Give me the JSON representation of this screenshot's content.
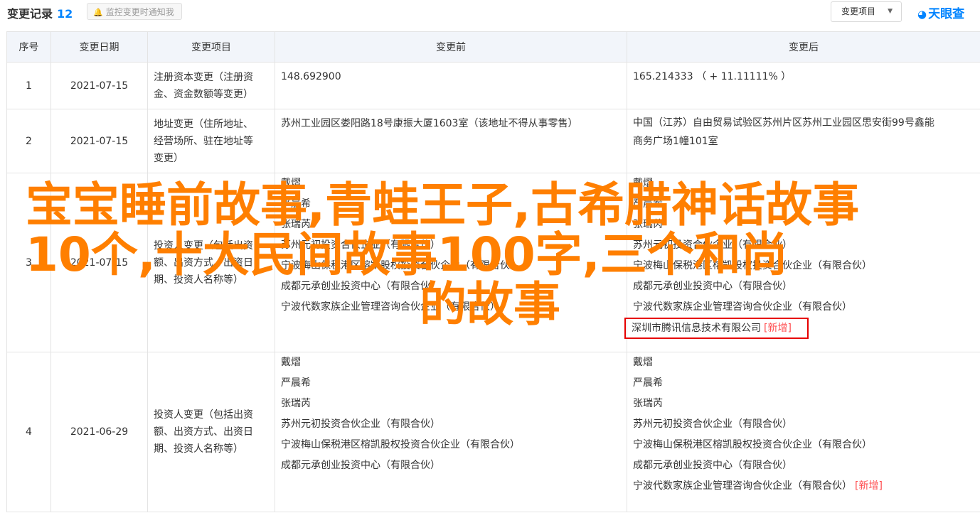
{
  "header": {
    "title": "变更记录",
    "count": "12",
    "notify_label": "监控变更时通知我",
    "filter_label": "变更项目",
    "brand": "天眼查"
  },
  "table": {
    "columns": [
      "序号",
      "变更日期",
      "变更项目",
      "变更前",
      "变更后"
    ],
    "rows": [
      {
        "index": "1",
        "date": "2021-07-15",
        "item": [
          "注册资本变更（注册资",
          "金、资金数额等变更）"
        ],
        "before": [
          "148.692900"
        ],
        "after": [
          "165.214333 （ + 11.11111% ）"
        ]
      },
      {
        "index": "2",
        "date": "2021-07-15",
        "item": [
          "地址变更（住所地址、",
          "经营场所、驻在地址等",
          "变更）"
        ],
        "before": [
          "苏州工业园区娄阳路18号康振大厦1603室（该地址不得从事零售）"
        ],
        "after": [
          "中国（江苏）自由贸易试验区苏州片区苏州工业园区思安街99号鑫能",
          "商务广场1幢101室"
        ]
      },
      {
        "index": "3",
        "date": "2021-07-15",
        "item": [
          "投资人变更（包括出资",
          "额、出资方式、出资日",
          "期、投资人名称等）"
        ],
        "before": [
          "戴熠",
          "严晨希",
          "张瑞芮",
          "苏州元初投资合伙企业（有限合伙）",
          "宁波梅山保税港区榕凯股权投资合伙企业（有限合伙）",
          "成都元承创业投资中心（有限合伙）",
          "宁波代数家族企业管理咨询合伙企业（有限合伙）"
        ],
        "after": [
          "戴熠",
          "严晨希",
          "张瑞芮",
          "苏州元初投资合伙企业（有限合伙）",
          "宁波梅山保税港区榕凯股权投资合伙企业（有限合伙）",
          "成都元承创业投资中心（有限合伙）",
          "宁波代数家族企业管理咨询合伙企业（有限合伙）",
          "深圳市腾讯信息技术有限公司"
        ],
        "after_new_tag": "[新增]"
      },
      {
        "index": "4",
        "date": "2021-06-29",
        "item": [
          "投资人变更（包括出资",
          "额、出资方式、出资日",
          "期、投资人名称等）"
        ],
        "before": [
          "戴熠",
          "严晨希",
          "张瑞芮",
          "苏州元初投资合伙企业（有限合伙）",
          "宁波梅山保税港区榕凯股权投资合伙企业（有限合伙）",
          "成都元承创业投资中心（有限合伙）"
        ],
        "after": [
          "戴熠",
          "严晨希",
          "张瑞芮",
          "苏州元初投资合伙企业（有限合伙）",
          "宁波梅山保税港区榕凯股权投资合伙企业（有限合伙）",
          "成都元承创业投资中心（有限合伙）",
          "宁波代数家族企业管理咨询合伙企业（有限合伙）"
        ],
        "after_new_tag": "[新增]"
      }
    ]
  },
  "overlay": {
    "line1": "宝宝睡前故事,青蛙王子,古希腊神话故事",
    "line2": "10个,十大民间故事100字,三个和尚",
    "line3": "的故事"
  },
  "colors": {
    "accent_blue": "#0084ff",
    "change_red": "#ff4d4f",
    "highlight_box": "#e60000",
    "overlay_orange": "#ff7f00",
    "header_bg": "#f2f5fa"
  }
}
